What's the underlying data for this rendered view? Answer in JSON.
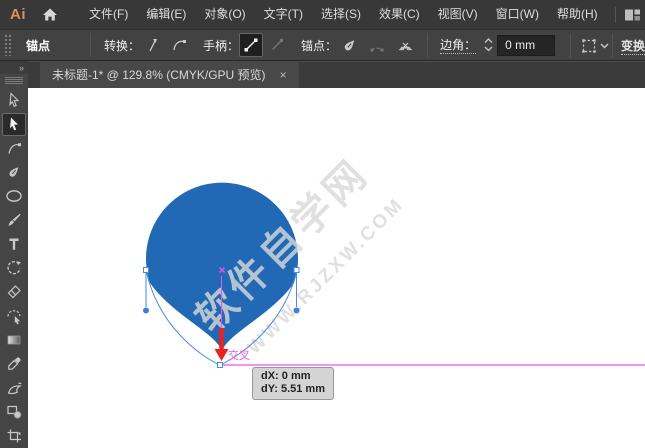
{
  "app": {
    "logo_text": "Ai"
  },
  "menubar": {
    "items": [
      "文件(F)",
      "编辑(E)",
      "对象(O)",
      "文字(T)",
      "选择(S)",
      "效果(C)",
      "视图(V)",
      "窗口(W)",
      "帮助(H)"
    ]
  },
  "controlbar": {
    "panel_label": "锚点",
    "convert_label": "转换：",
    "handles_label": "手柄：",
    "anchor_label": "锚点：",
    "corner_label": "边角：",
    "corner_value": "0 mm",
    "transform_label": "变换"
  },
  "toolspanel": {
    "expand_glyph": "»"
  },
  "tabbar": {
    "document_title": "未标题-1* @ 129.8% (CMYK/GPU 预览)",
    "close_glyph": "×"
  },
  "canvas": {
    "watermark": {
      "line1": "软件自学网",
      "line2": "WWW.RJZXW.COM"
    },
    "measure_label": "交叉",
    "tooltip": {
      "dx": "dX: 0 mm",
      "dy": "dY: 5.51 mm"
    }
  },
  "colors": {
    "shape_fill": "#2169b5",
    "path_stroke": "#4a8ae0",
    "measure_magenta": "#f050f0",
    "arrow_red": "#e8231d",
    "logo_orange": "#dd8f5c"
  }
}
